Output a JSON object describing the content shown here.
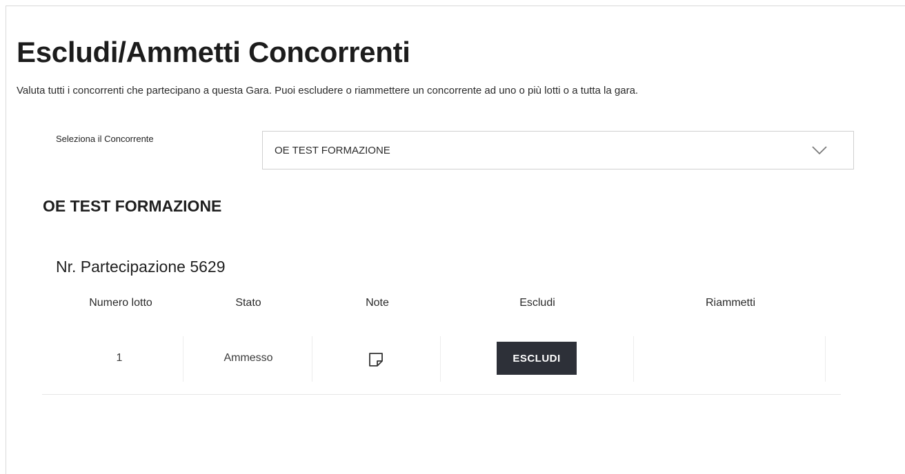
{
  "page": {
    "title": "Escludi/Ammetti Concorrenti",
    "description": "Valuta tutti i concorrenti che partecipano a questa Gara. Puoi escludere o riammettere un concorrente ad uno o più lotti o a tutta la gara."
  },
  "selector": {
    "label": "Seleziona il Concorrente",
    "selected": "OE TEST FORMAZIONE",
    "icon": "chevron-down-icon"
  },
  "competitor": {
    "name": "OE TEST FORMAZIONE"
  },
  "participation": {
    "title": "Nr. Partecipazione 5629",
    "columns": [
      "Numero lotto",
      "Stato",
      "Note",
      "Escludi",
      "Riammetti"
    ],
    "rows": [
      {
        "lotto": "1",
        "stato": "Ammesso",
        "note_icon": "note-icon",
        "escludi_label": "ESCLUDI",
        "riammetti_label": ""
      }
    ]
  },
  "colors": {
    "button_bg": "#2d3038",
    "button_text": "#ffffff",
    "border": "#cfcfcf"
  }
}
